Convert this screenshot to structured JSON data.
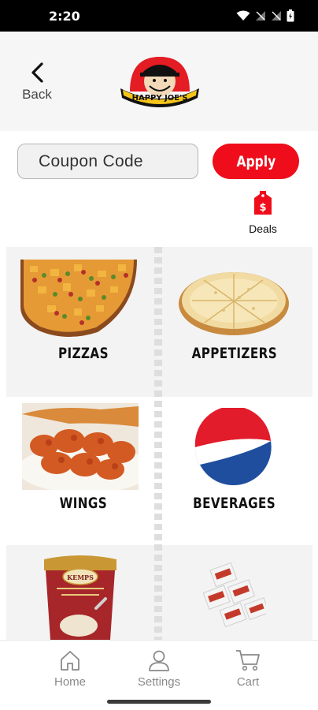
{
  "status_bar": {
    "time": "2:20"
  },
  "header": {
    "back_label": "Back",
    "logo_text": "HAPPY JOE'S"
  },
  "coupon": {
    "placeholder": "Coupon Code",
    "apply_label": "Apply"
  },
  "deals": {
    "label": "Deals"
  },
  "categories": [
    {
      "label": "PIZZAS"
    },
    {
      "label": "APPETIZERS"
    },
    {
      "label": "WINGS"
    },
    {
      "label": "BEVERAGES"
    },
    {
      "label": "",
      "image_text": "KEMPS"
    },
    {
      "label": ""
    }
  ],
  "bottom_nav": [
    {
      "label": "Home"
    },
    {
      "label": "Settings"
    },
    {
      "label": "Cart"
    }
  ],
  "colors": {
    "accent": "#ef0d1b",
    "nav_gray": "#8a8a8a",
    "pepsi_blue": "#1f4e9e",
    "pepsi_red": "#e21c2a"
  }
}
